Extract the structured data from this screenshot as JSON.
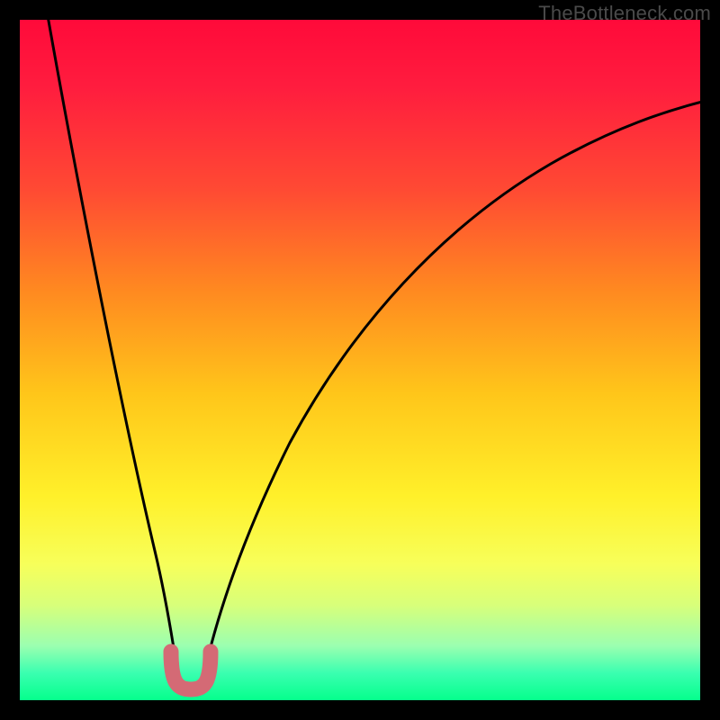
{
  "watermark": "TheBottleneck.com",
  "chart_data": {
    "type": "line",
    "title": "",
    "xlabel": "",
    "ylabel": "",
    "xlim": [
      0,
      100
    ],
    "ylim": [
      0,
      100
    ],
    "description": "Two smooth black curves descending from upper edges to a common minimum near x≈24, y≈2, over a vertical red→yellow→green gradient. A short pink U-shaped segment sits at the minimum.",
    "series": [
      {
        "name": "left-branch",
        "x": [
          4,
          6,
          8,
          10,
          12,
          14,
          16,
          18,
          20,
          21.5,
          23
        ],
        "y": [
          100,
          86,
          73,
          61,
          50,
          40,
          31,
          22,
          14,
          8,
          3
        ]
      },
      {
        "name": "right-branch",
        "x": [
          27,
          29,
          32,
          36,
          41,
          47,
          54,
          62,
          71,
          81,
          92,
          100
        ],
        "y": [
          3,
          9,
          18,
          29,
          40,
          50,
          59,
          67,
          74,
          80,
          85,
          88
        ]
      },
      {
        "name": "pink-u",
        "x": [
          21.5,
          22.5,
          24,
          25.5,
          26.5
        ],
        "y": [
          7,
          2.5,
          1.8,
          2.5,
          7
        ]
      }
    ],
    "colors": {
      "curve": "#000000",
      "pink": "#d46a75",
      "gradient_top": "#ff0a3a",
      "gradient_mid": "#fff02a",
      "gradient_bottom": "#05ff8c"
    }
  }
}
